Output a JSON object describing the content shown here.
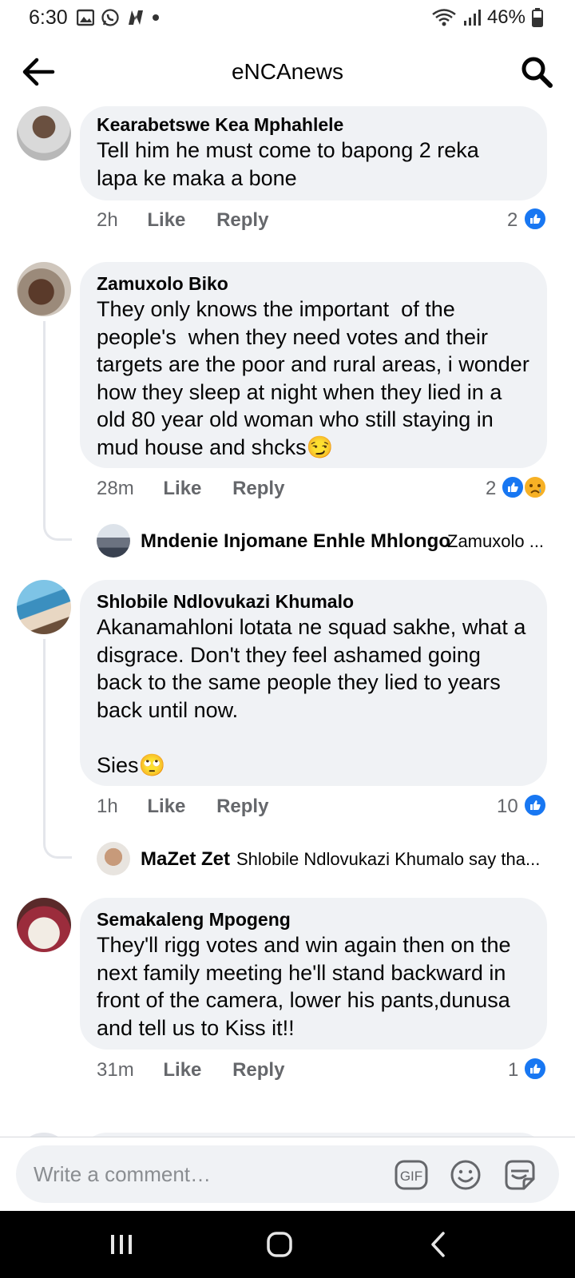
{
  "status_bar": {
    "time": "6:30",
    "battery": "46%"
  },
  "header": {
    "title": "eNCAnews"
  },
  "comments": [
    {
      "author": "Kearabetswe Kea Mphahlele",
      "text": "Tell him he must come to bapong 2 reka\nlapa ke maka a bone",
      "time": "2h",
      "like_label": "Like",
      "reply_label": "Reply",
      "reaction_count": "2",
      "reactions": [
        "like"
      ]
    },
    {
      "author": "Zamuxolo Biko",
      "text": "They only knows the important  of the\npeople's  when they need votes and their\ntargets are the poor and rural areas, i wonder\nhow they sleep at night when they lied in a\nold 80 year old woman who still staying in\nmud house and shcks😏",
      "time": "28m",
      "like_label": "Like",
      "reply_label": "Reply",
      "reaction_count": "2",
      "reactions": [
        "like",
        "sad"
      ],
      "reply": {
        "author": "Mndenie Injomane Enhle Mhlongo",
        "preview": "Zamuxolo ..."
      }
    },
    {
      "author": "Shlobile Ndlovukazi Khumalo",
      "text": "Akanamahloni lotata ne squad sakhe, what a\ndisgrace. Don't they feel ashamed going\nback to the same people they lied to years\nback until now.\n\nSies🙄",
      "time": "1h",
      "like_label": "Like",
      "reply_label": "Reply",
      "reaction_count": "10",
      "reactions": [
        "like"
      ],
      "reply": {
        "author": "MaZet Zet",
        "preview": "Shlobile Ndlovukazi Khumalo say tha..."
      }
    },
    {
      "author": "Semakaleng Mpogeng",
      "text": "They'll rigg votes and win again then on the\nnext family meeting he'll stand backward in\nfront of the camera, lower his pants,dunusa\nand tell us to Kiss it!!",
      "time": "31m",
      "like_label": "Like",
      "reply_label": "Reply",
      "reaction_count": "1",
      "reactions": [
        "like"
      ]
    }
  ],
  "composer": {
    "placeholder": "Write a comment…",
    "gif_label": "GIF"
  },
  "colors": {
    "accent": "#1877f2",
    "bubble": "#f0f2f5",
    "meta": "#65676b"
  }
}
